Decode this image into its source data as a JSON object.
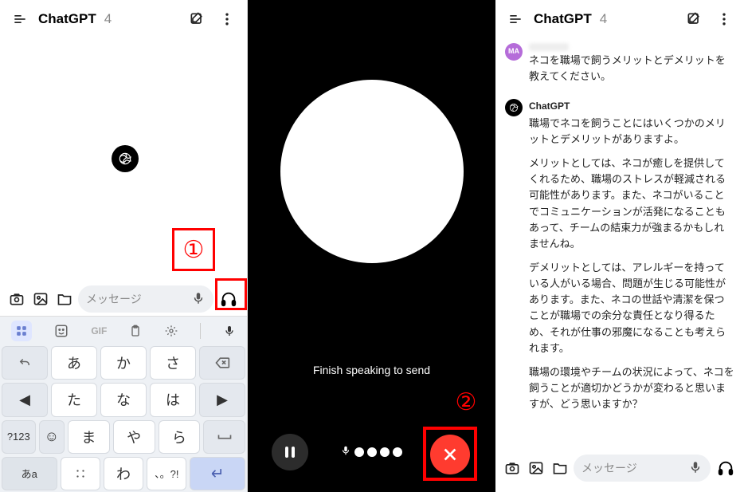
{
  "header": {
    "title": "ChatGPT",
    "subtitle": "4"
  },
  "callouts": {
    "one": "①",
    "two": "②"
  },
  "input": {
    "placeholder": "メッセージ"
  },
  "keyboard_toolbar": {
    "gif": "GIF"
  },
  "keyboard": {
    "row1": [
      "←",
      "あ",
      "か",
      "さ",
      "⌫"
    ],
    "row2": [
      "◀",
      "た",
      "な",
      "は",
      "▶"
    ],
    "row3_left": "?123",
    "row3_face": "☺",
    "row3": [
      "ま",
      "や",
      "ら"
    ],
    "row3_right": "␣",
    "row4_left": "あa",
    "row4": [
      "",
      "わ",
      ""
    ],
    "row4_right": "↵"
  },
  "center": {
    "finish_text": "Finish speaking to send"
  },
  "chat": {
    "user_avatar_initials": "MA",
    "user_message": "ネコを職場で飼うメリットとデメリットを教えてください。",
    "gpt_name": "ChatGPT",
    "gpt_p1": "職場でネコを飼うことにはいくつかのメリットとデメリットがありますよ。",
    "gpt_p2": "メリットとしては、ネコが癒しを提供してくれるため、職場のストレスが軽減される可能性があります。また、ネコがいることでコミュニケーションが活発になることもあって、チームの結束力が強まるかもしれませんね。",
    "gpt_p3": "デメリットとしては、アレルギーを持っている人がいる場合、問題が生じる可能性があります。また、ネコの世話や清潔を保つことが職場での余分な責任となり得るため、それが仕事の邪魔になることも考えられます。",
    "gpt_p4": "職場の環境やチームの状況によって、ネコを飼うことが適切かどうかが変わると思いますが、どう思いますか？"
  }
}
